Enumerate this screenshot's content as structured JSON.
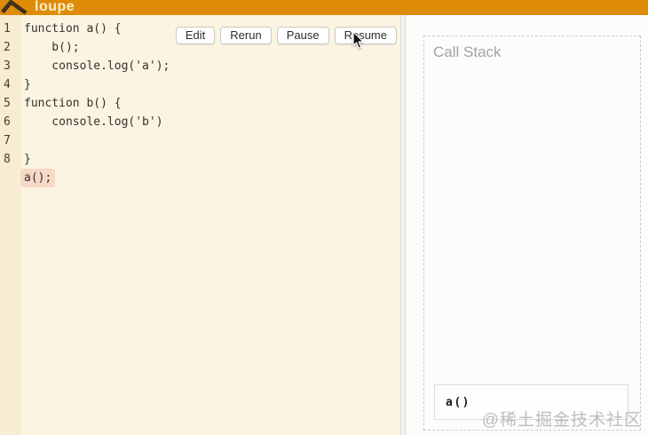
{
  "header": {
    "title": "loupe"
  },
  "toolbar": {
    "buttons": [
      {
        "label": "Edit"
      },
      {
        "label": "Rerun"
      },
      {
        "label": "Pause"
      },
      {
        "label": "Resume"
      }
    ]
  },
  "editor": {
    "lines": [
      {
        "num": "1",
        "code": "function a() {",
        "highlight": false
      },
      {
        "num": "2",
        "code": "    b();",
        "highlight": false
      },
      {
        "num": "3",
        "code": "    console.log('a');",
        "highlight": false
      },
      {
        "num": "4",
        "code": "}",
        "highlight": false
      },
      {
        "num": "5",
        "code": "function b() {",
        "highlight": false
      },
      {
        "num": "6",
        "code": "    console.log('b')",
        "highlight": false
      },
      {
        "num": "7",
        "code": "",
        "highlight": false
      },
      {
        "num": "8",
        "code": "}",
        "highlight": false
      },
      {
        "num": "",
        "code": "a();",
        "highlight": true
      }
    ]
  },
  "call_stack": {
    "title": "Call Stack",
    "frames": [
      {
        "label": "a()"
      }
    ]
  },
  "watermark": "@稀土掘金技术社区",
  "colors": {
    "header_orange": "#DE8C08",
    "header_title": "#F8EFCD",
    "editor_bg": "#FBF4E2",
    "gutter_bg": "#F8EDD2",
    "line_highlight": "#F8D8C6",
    "dashed_border": "#C9C9C9",
    "stack_title_gray": "#A3A3A3"
  }
}
